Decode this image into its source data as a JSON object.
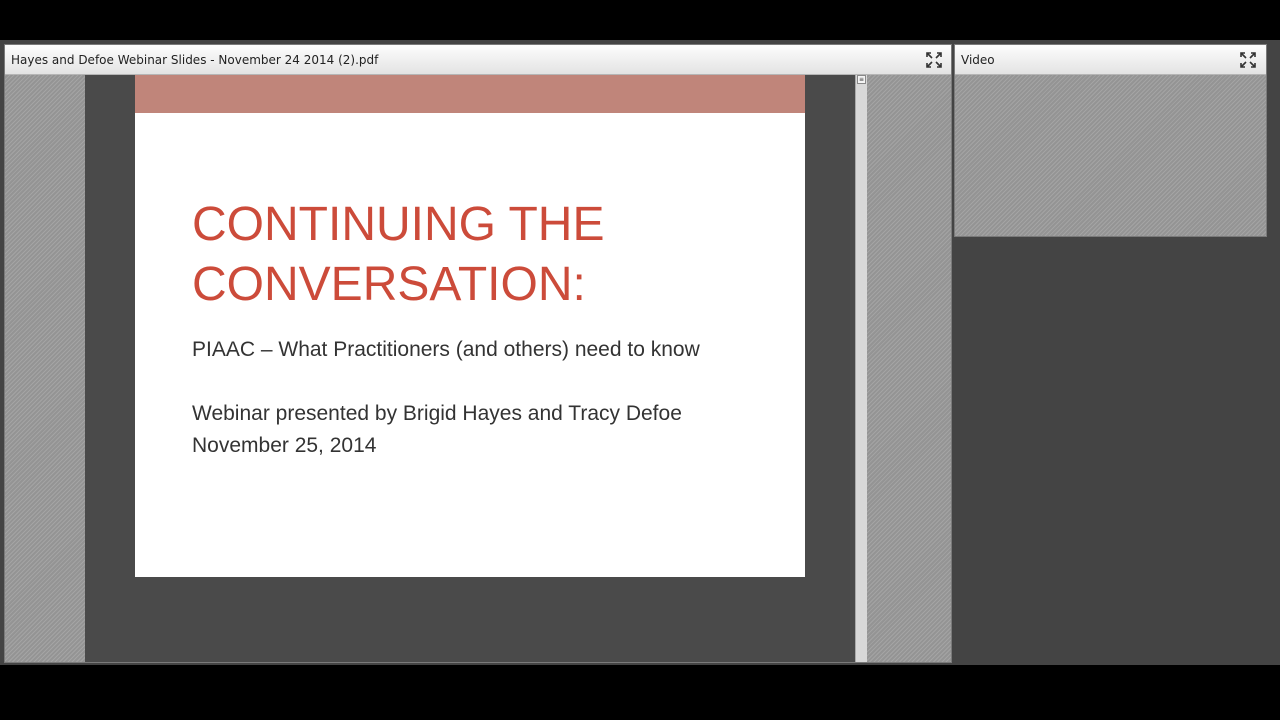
{
  "document_pod": {
    "title": "Hayes and Defoe Webinar Slides - November 24 2014 (2).pdf",
    "maximize_icon": "expand-arrows-icon",
    "slide": {
      "title_line1": "CONTINUING THE",
      "title_line2": "CONVERSATION:",
      "subtitle": "PIAAC – What Practitioners (and others) need to know",
      "presenters": "Webinar presented by Brigid Hayes and Tracy Defoe",
      "date": "November 25, 2014",
      "accent_color": "#cc4b3a",
      "band_color": "#c0857a"
    },
    "scroll_up_glyph": "≡"
  },
  "video_pod": {
    "title": "Video",
    "maximize_icon": "expand-arrows-icon"
  }
}
